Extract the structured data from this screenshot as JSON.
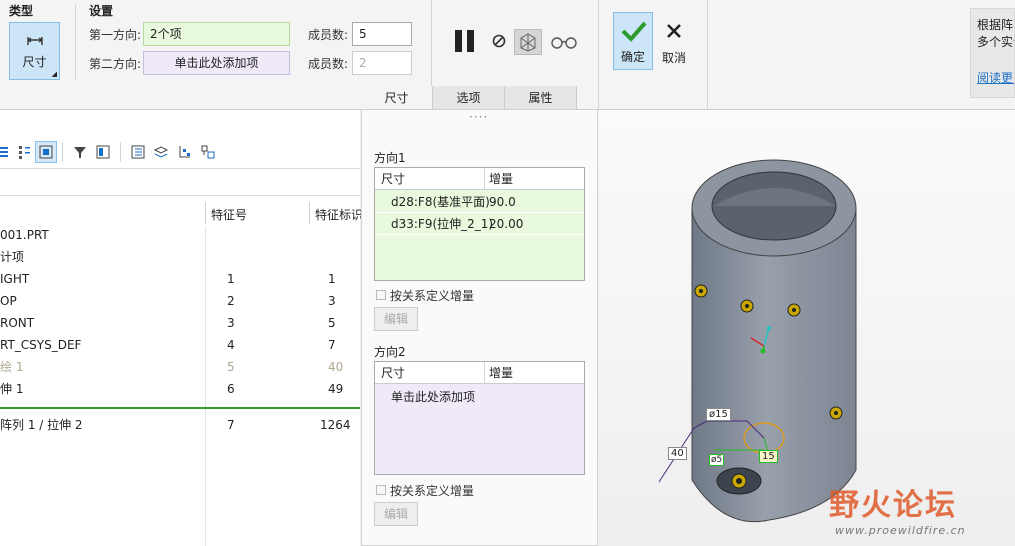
{
  "ribbon": {
    "type_section_label": "类型",
    "type_button_label": "尺寸",
    "settings_section_label": "设置",
    "dir1_label": "第一方向:",
    "dir1_value": "2个项",
    "dir2_label": "第二方向:",
    "dir2_value": "单击此处添加项",
    "members1_label": "成员数:",
    "members1_value": "5",
    "members2_label": "成员数:",
    "members2_value": "2",
    "ok_label": "确定",
    "cancel_label": "取消",
    "tabs": [
      "尺寸",
      "选项",
      "属性"
    ],
    "hint_line1": "根据阵列",
    "hint_line2": "多个实例",
    "hint_link": "阅读更多"
  },
  "tree": {
    "col_feat_num": "特征号",
    "col_feat_id": "特征标识",
    "rows": [
      {
        "name": "001.PRT",
        "num": "",
        "id": ""
      },
      {
        "name": "计项",
        "num": "",
        "id": ""
      },
      {
        "name": "IGHT",
        "num": "1",
        "id": "1"
      },
      {
        "name": "OP",
        "num": "2",
        "id": "3"
      },
      {
        "name": "RONT",
        "num": "3",
        "id": "5"
      },
      {
        "name": "RT_CSYS_DEF",
        "num": "4",
        "id": "7"
      },
      {
        "name": "绘 1",
        "num": "5",
        "id": "40"
      },
      {
        "name": "伸 1",
        "num": "6",
        "id": "49"
      }
    ],
    "new_row": {
      "name": "阵列 1 / 拉伸 2",
      "num": "7",
      "id": "1264"
    }
  },
  "panel": {
    "grip": "····",
    "dir1_title": "方向1",
    "dir2_title": "方向2",
    "col_dim": "尺寸",
    "col_inc": "增量",
    "dir1_rows": [
      {
        "dim": "d28:F8(基准平面)",
        "inc": "90.0"
      },
      {
        "dim": "d33:F9(拉伸_2_1)",
        "inc": "20.00"
      }
    ],
    "dir2_placeholder": "单击此处添加项",
    "relation_label": "按关系定义增量",
    "edit_label": "编辑"
  },
  "viewport": {
    "dim_diameter": "ø15",
    "dim_40": "40",
    "dim_15": "15",
    "dim_small": "ø5",
    "watermark_cn": "野火论坛",
    "watermark_url": "www.proewildfire.cn"
  },
  "colors": {
    "accent": "#0a84d8",
    "green_field": "#e9f9dd",
    "purple_field": "#efe9f8",
    "cylinder": "#8a93a0"
  }
}
